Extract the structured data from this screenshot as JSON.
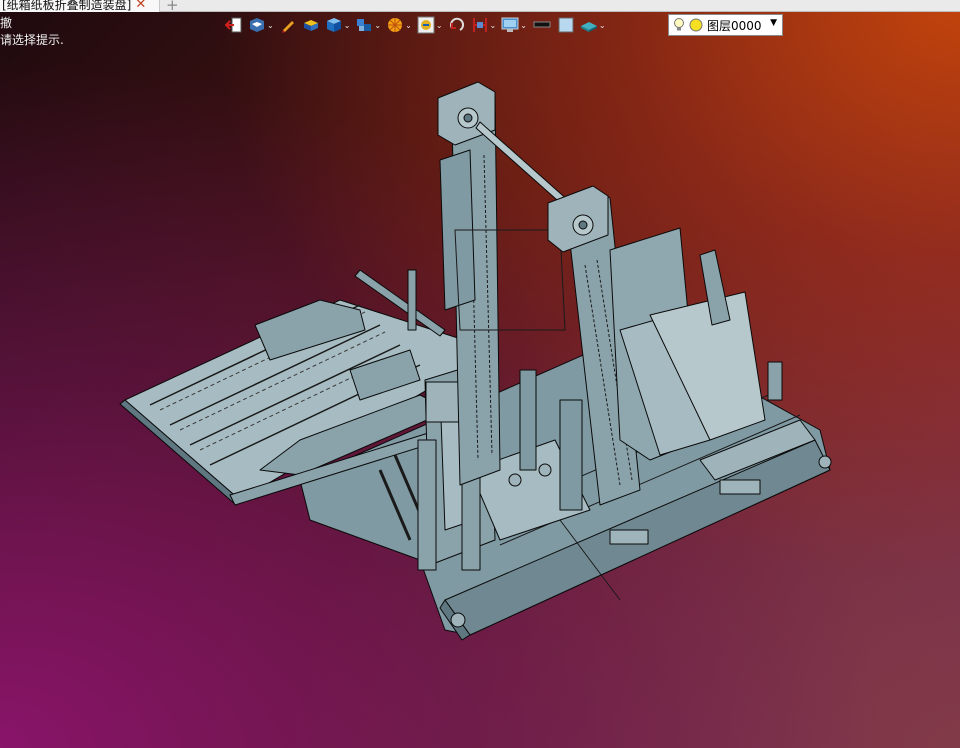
{
  "tab": {
    "title": "[纸箱纸板折叠制造装盘]",
    "close_glyph": "✕",
    "new_tab_glyph": "+"
  },
  "command": {
    "name": "撤",
    "prompt": "请选择提示."
  },
  "toolbar": {
    "tools": [
      {
        "name": "exit-icon",
        "dropdown": false
      },
      {
        "name": "view-icon",
        "dropdown": true
      },
      {
        "name": "pencil-icon",
        "dropdown": false
      },
      {
        "name": "layer-box-icon",
        "dropdown": false
      },
      {
        "name": "cube-icon",
        "dropdown": true
      },
      {
        "name": "multi-view-icon",
        "dropdown": true
      },
      {
        "name": "color-wheel-icon",
        "dropdown": true
      },
      {
        "name": "render-mode-icon",
        "dropdown": true
      },
      {
        "name": "rotate-icon",
        "dropdown": false
      },
      {
        "name": "section-icon",
        "dropdown": true
      },
      {
        "name": "display-icon",
        "dropdown": true
      },
      {
        "name": "line-style-icon",
        "dropdown": false
      },
      {
        "name": "fill-color-icon",
        "dropdown": false
      },
      {
        "name": "material-icon",
        "dropdown": true
      }
    ]
  },
  "layer": {
    "name": "图层0000"
  },
  "colors": {
    "background_top_right": "#b84010",
    "background_bottom_left": "#8a1670",
    "model_fill": "#7f9aa3",
    "model_line": "#0a0a0a"
  }
}
